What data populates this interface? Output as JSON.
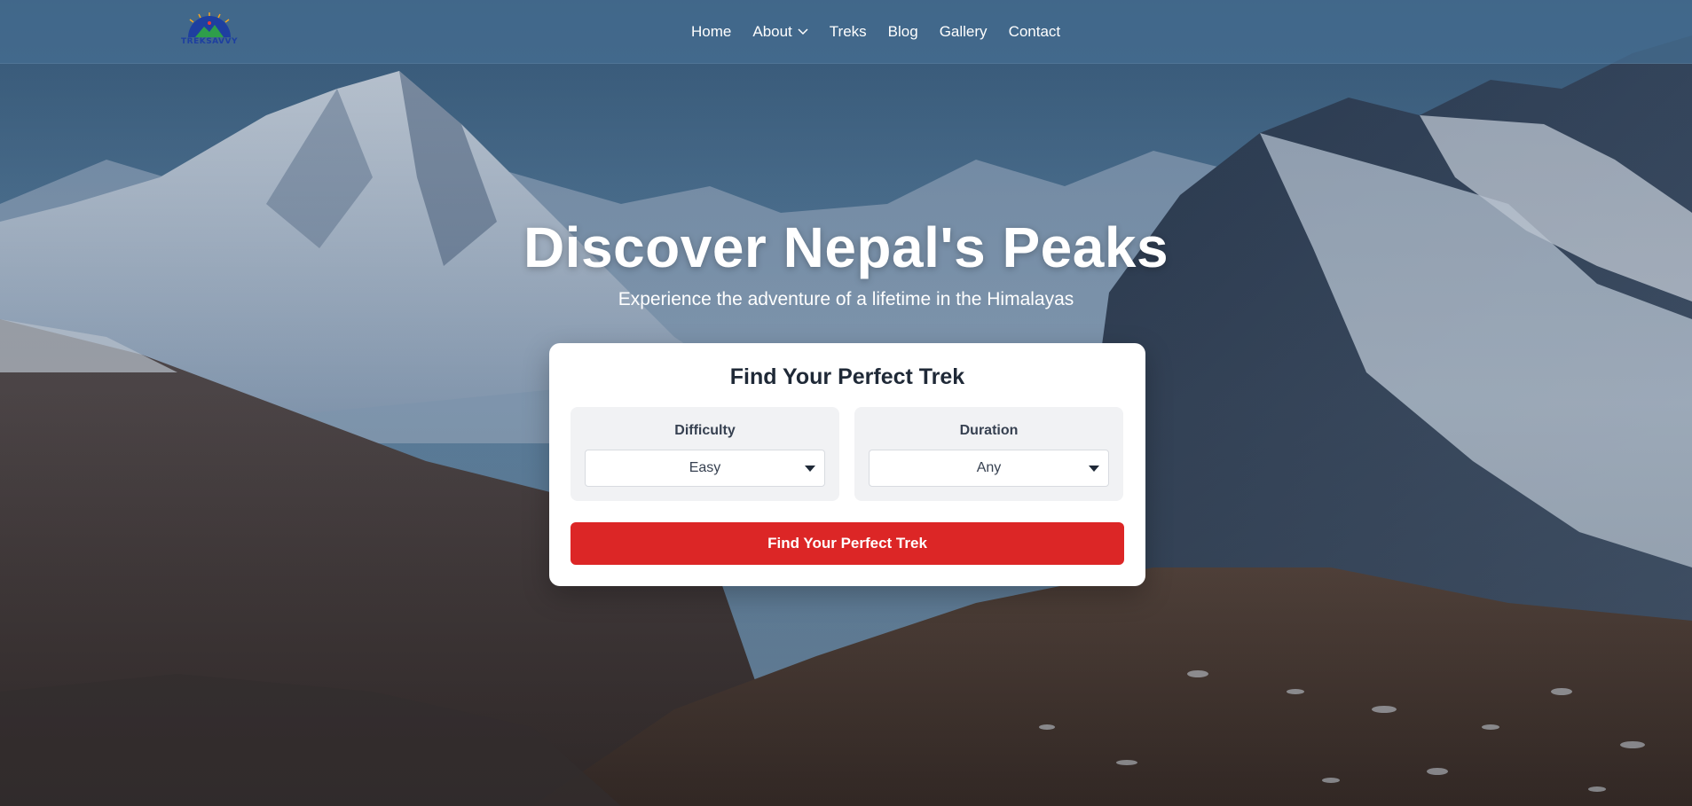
{
  "brand": {
    "logo_text": "TREKSAVVY"
  },
  "nav": {
    "items": [
      {
        "label": "Home"
      },
      {
        "label": "About",
        "has_dropdown": true
      },
      {
        "label": "Treks"
      },
      {
        "label": "Blog"
      },
      {
        "label": "Gallery"
      },
      {
        "label": "Contact"
      }
    ]
  },
  "hero": {
    "title": "Discover Nepal's Peaks",
    "subtitle": "Experience the adventure of a lifetime in the Himalayas"
  },
  "search": {
    "title": "Find Your Perfect Trek",
    "difficulty": {
      "label": "Difficulty",
      "value": "Easy"
    },
    "duration": {
      "label": "Duration",
      "value": "Any"
    },
    "button_label": "Find Your Perfect Trek"
  },
  "colors": {
    "accent": "#dc2626",
    "nav_bg": "#466e91",
    "card_bg": "#ffffff",
    "filter_bg": "#f1f2f4",
    "logo_blue": "#1e3fa0"
  }
}
